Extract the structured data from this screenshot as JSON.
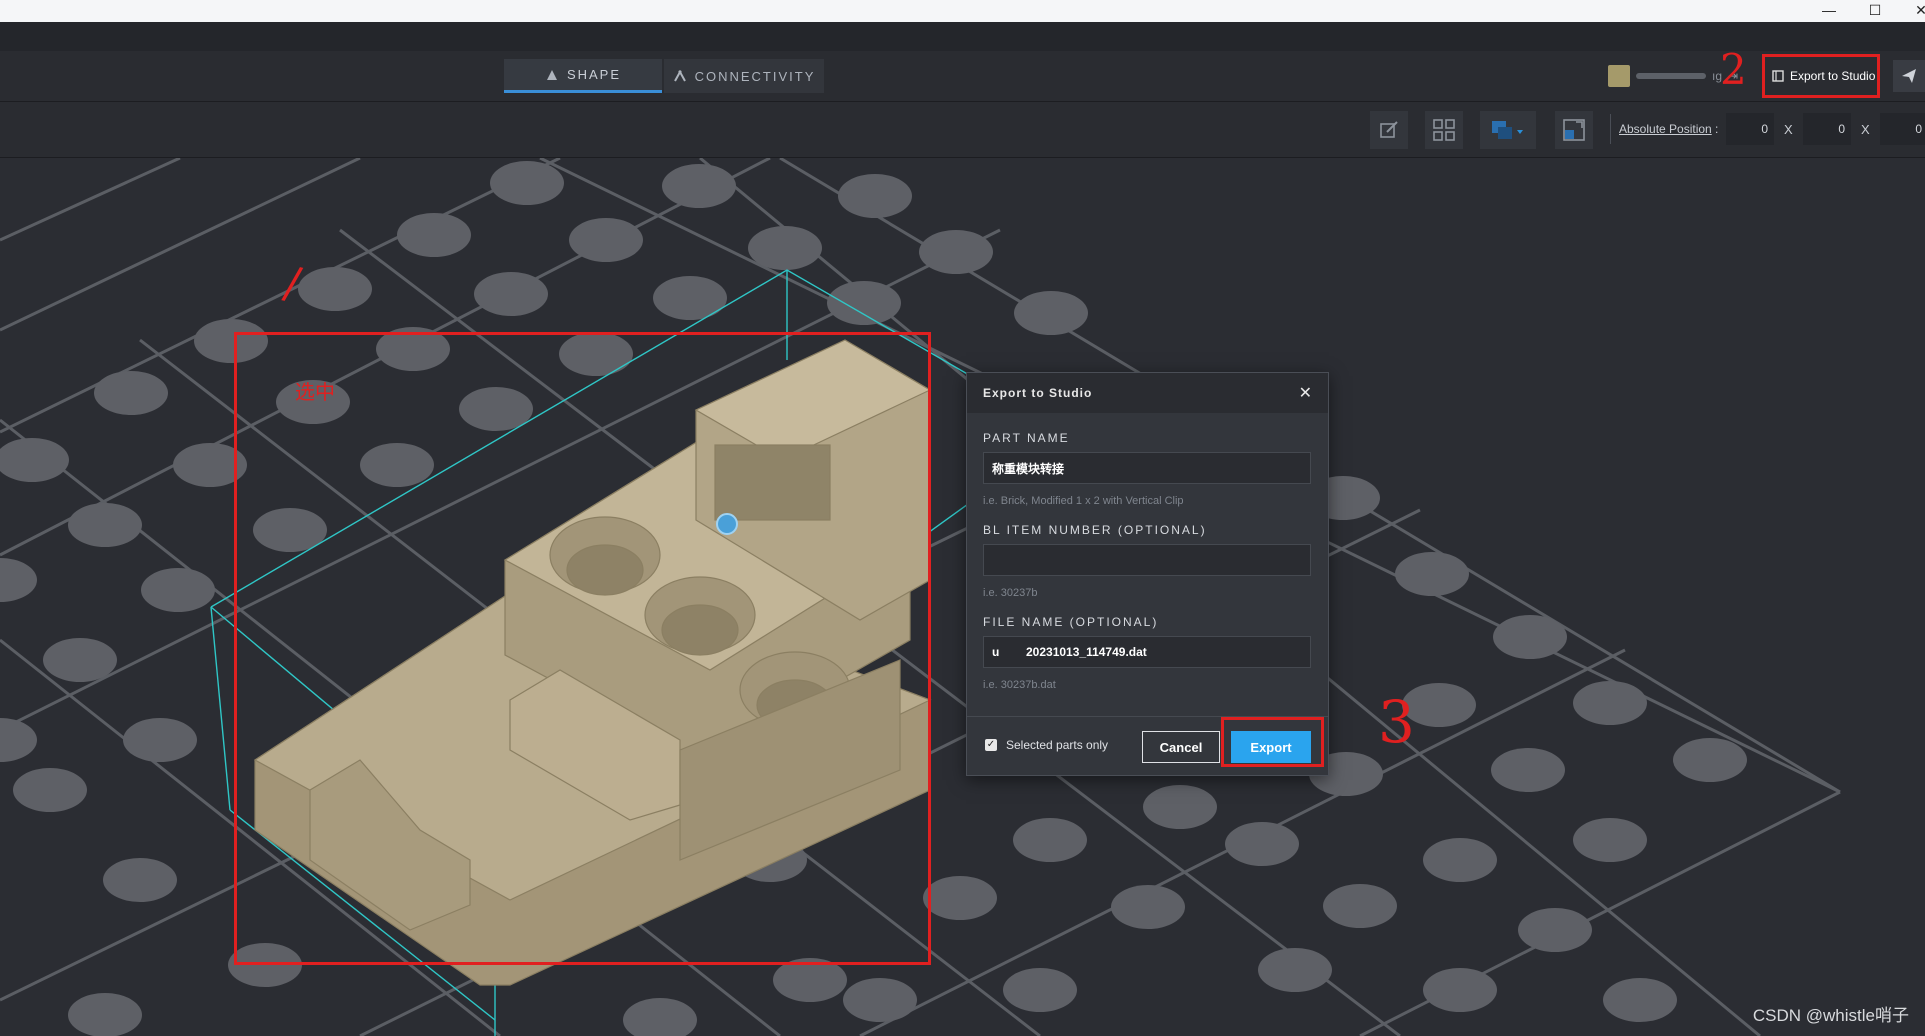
{
  "window": {
    "minimize_glyph": "—",
    "maximize_glyph": "☐",
    "close_glyph": "✕"
  },
  "tabs": [
    {
      "label": "SHAPE",
      "icon": "shape-icon",
      "active": true
    },
    {
      "label": "CONNECTIVITY",
      "icon": "connectivity-icon",
      "active": false
    }
  ],
  "user": {
    "name_suffix": "ıg"
  },
  "header": {
    "export_button_label": "Export to Studio"
  },
  "toolbar": {
    "position_label": "Absolute Position",
    "position_colon": ":",
    "x_separator": "X",
    "position_values": [
      "0",
      "0",
      "0"
    ]
  },
  "dialog": {
    "title": "Export to Studio",
    "part_name_label": "PART NAME",
    "part_name_value": "称重模块转接",
    "part_name_hint": "i.e. Brick, Modified 1 x 2 with Vertical Clip",
    "bl_item_label": "BL ITEM NUMBER (OPTIONAL)",
    "bl_item_value": "",
    "bl_item_hint": "i.e. 30237b",
    "file_name_label": "FILE NAME (OPTIONAL)",
    "file_name_value": "u        20231013_114749.dat",
    "file_name_hint": "i.e. 30237b.dat",
    "selected_only_label": "Selected parts only",
    "selected_only_checked": true,
    "cancel_label": "Cancel",
    "export_label": "Export"
  },
  "annotations": {
    "mark_1": "/",
    "selected_text": "选中",
    "mark_2": "2",
    "mark_3": "3"
  },
  "watermark": "CSDN @whistle哨子",
  "colors": {
    "accent": "#2aa4ee",
    "annotation": "#e02020",
    "part": "#b5a88a",
    "bounding": "#2fc6c6"
  }
}
